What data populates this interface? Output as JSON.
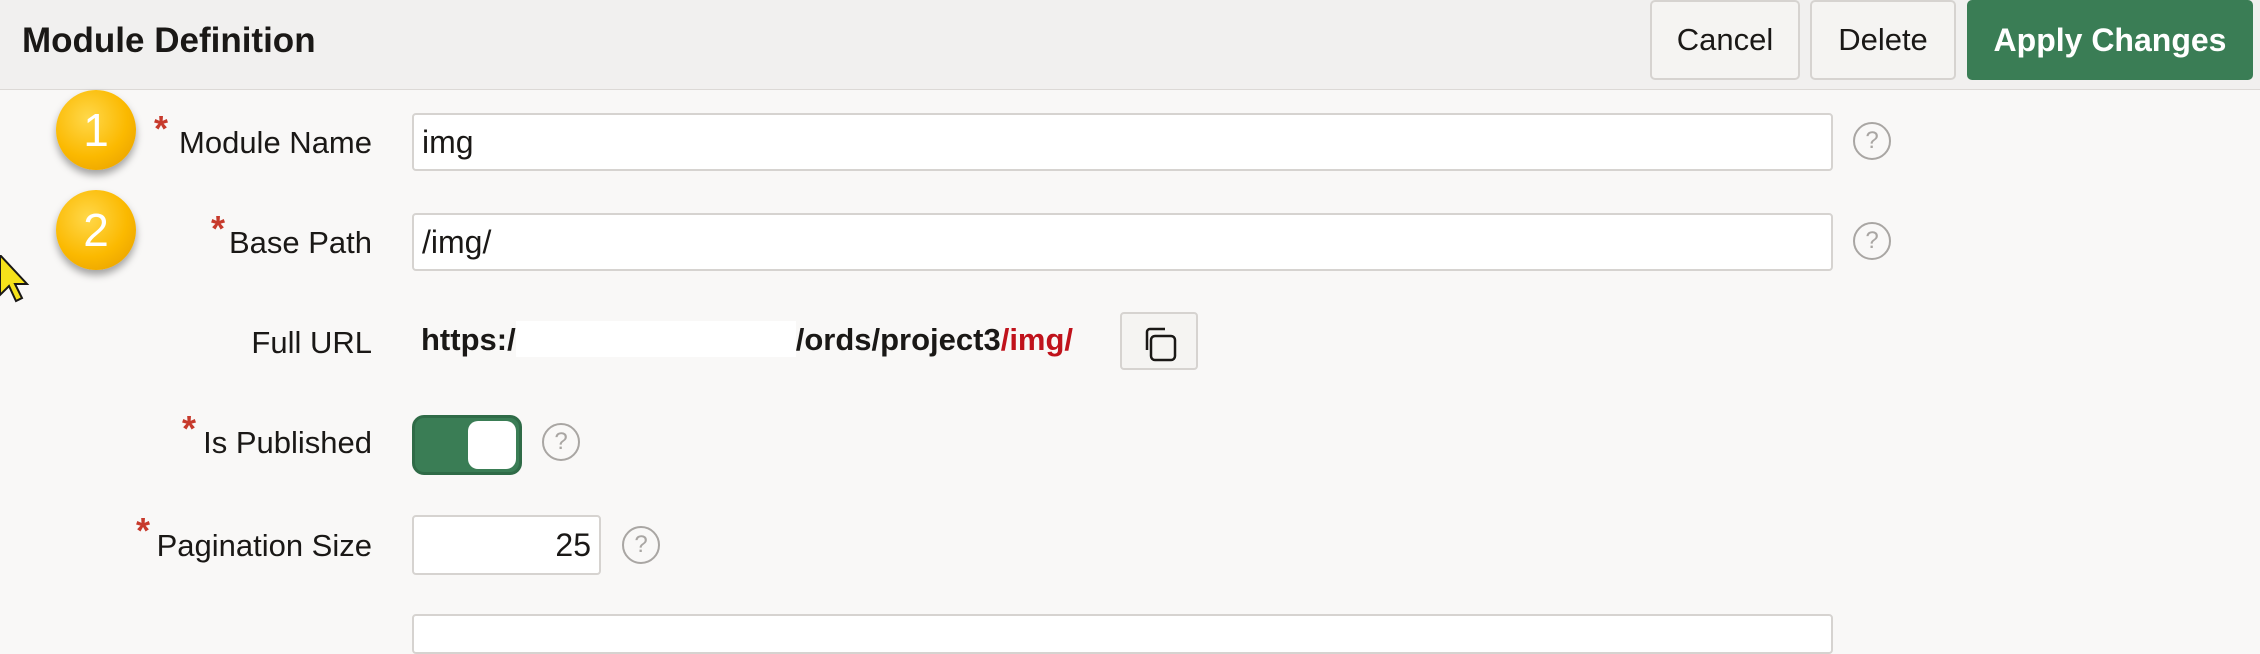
{
  "header": {
    "title": "Module Definition",
    "cancel_label": "Cancel",
    "delete_label": "Delete",
    "apply_label": "Apply Changes"
  },
  "badges": [
    "1",
    "2"
  ],
  "form": {
    "module_name": {
      "label": "Module Name",
      "required": "*",
      "value": "img"
    },
    "base_path": {
      "label": "Base Path",
      "required": "*",
      "value": "/img/"
    },
    "full_url": {
      "label": "Full URL",
      "prefix": "https:/",
      "middle": "/ords/project3",
      "tail": "/img/"
    },
    "is_published": {
      "label": "Is Published",
      "required": "*",
      "checked": true
    },
    "pagination_size": {
      "label": "Pagination Size",
      "required": "*",
      "value": "25"
    },
    "help_glyph": "?"
  },
  "icons": [
    "help-icon",
    "copy-icon",
    "mouse-pointer-icon"
  ],
  "colors": {
    "primary": "#3a7d55",
    "required": "#c73a2c",
    "url_tail": "#c0121b",
    "badge": "#fbb900"
  }
}
